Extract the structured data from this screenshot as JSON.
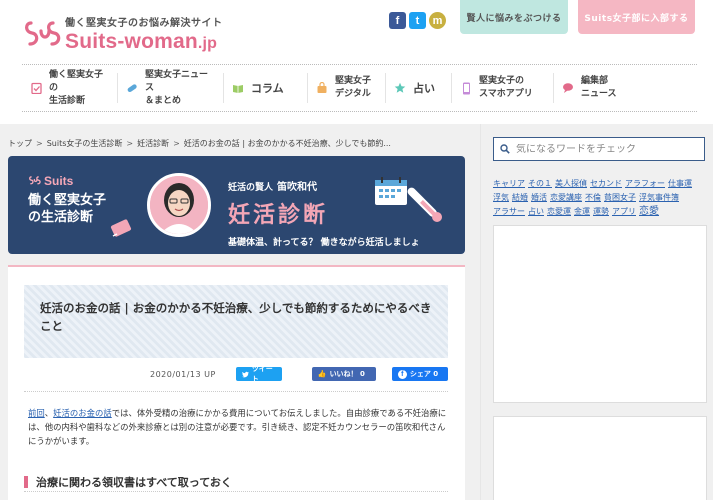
{
  "header": {
    "tagline": "働く堅実女子のお悩み解決サイト",
    "logo_main": "Suits",
    "logo_dash": "-woman",
    "logo_tld": ".jp",
    "consult_button": "賢人に悩みをぶつける",
    "join_button": "Suits女子部に入部する",
    "social": [
      {
        "glyph": "f",
        "icon": "facebook-icon",
        "color": "#3b5998"
      },
      {
        "glyph": "t",
        "icon": "twitter-icon",
        "color": "#1da1f2"
      },
      {
        "glyph": "m",
        "icon": "mixi-icon",
        "color": "#c8b040"
      }
    ]
  },
  "nav": {
    "items": [
      {
        "label": "働く堅実女子の\n生活診断",
        "icon": "clipboard-check-icon",
        "color": "#e26a8a"
      },
      {
        "label": "堅実女子ニュース\n＆まとめ",
        "icon": "pill-icon",
        "color": "#5aa7d9"
      },
      {
        "label": "コラム",
        "icon": "book-icon",
        "color": "#9ccc65"
      },
      {
        "label": "堅実女子\nデジタル",
        "icon": "bag-icon",
        "color": "#f0b060"
      },
      {
        "label": "占い",
        "icon": "star-icon",
        "color": "#5dc8b8"
      },
      {
        "label": "堅実女子の\nスマホアプリ",
        "icon": "smartphone-icon",
        "color": "#c58bd8"
      },
      {
        "label": "編集部\nニュース",
        "icon": "speech-bubble-icon",
        "color": "#e26a8a"
      }
    ]
  },
  "breadcrumb": {
    "items": [
      "トップ",
      "Suits女子の生活診断",
      "妊活診断",
      "妊活のお金の話 | お金のかかる不妊治療、少しでも節約..."
    ]
  },
  "hero": {
    "brand": "Suits",
    "title": "働く堅実女子\nの生活診断",
    "sub_label": "妊活の賢人",
    "sub_name": "笛吹和代",
    "big": "妊活診断",
    "caption": "基礎体温、計ってる？ 働きながら妊活しましょ"
  },
  "article": {
    "title": "妊活のお金の話 | お金のかかる不妊治療、少しでも節約するためにやるべきこと",
    "date": "2020/01/13 UP",
    "tweet_label": "ツイート",
    "like_label": "いいね！ 0",
    "share_label": "シェア 0",
    "intro_link1": "前回",
    "intro_sep": "、",
    "intro_link2": "妊活のお金の話",
    "intro_text": "では、体外受精の治療にかかる費用についてお伝えしました。自由診療である不妊治療には、他の内科や歯科などの外来診療とは別の注意が必要です。引き続き、認定不妊カウンセラーの笛吹和代さんにうかがいます。",
    "heading": "治療に関わる領収書はすべて取っておく"
  },
  "sidebar": {
    "search_placeholder": "気になるワードをチェック",
    "tags": [
      {
        "t": "キャリア",
        "lg": false
      },
      {
        "t": "その１",
        "lg": false
      },
      {
        "t": "美人探偵",
        "lg": false
      },
      {
        "t": "セカンド",
        "lg": false
      },
      {
        "t": "アラフォー",
        "lg": false
      },
      {
        "t": "仕事運",
        "lg": false
      },
      {
        "t": "浮気",
        "lg": false
      },
      {
        "t": "結婚",
        "lg": false
      },
      {
        "t": "婚活",
        "lg": false
      },
      {
        "t": "恋愛講座",
        "lg": false
      },
      {
        "t": "不倫",
        "lg": false
      },
      {
        "t": "貧困女子",
        "lg": false
      },
      {
        "t": "浮気事件簿",
        "lg": false
      },
      {
        "t": "アラサー",
        "lg": false
      },
      {
        "t": "占い",
        "lg": false
      },
      {
        "t": "恋愛運",
        "lg": false
      },
      {
        "t": "金運",
        "lg": false
      },
      {
        "t": "運勢",
        "lg": false
      },
      {
        "t": "アプリ",
        "lg": false
      },
      {
        "t": "恋愛",
        "lg": true
      }
    ]
  },
  "colors": {
    "accent_pink": "#e26a8a",
    "hero_navy": "#2c4770",
    "link_blue": "#2b62b0"
  }
}
